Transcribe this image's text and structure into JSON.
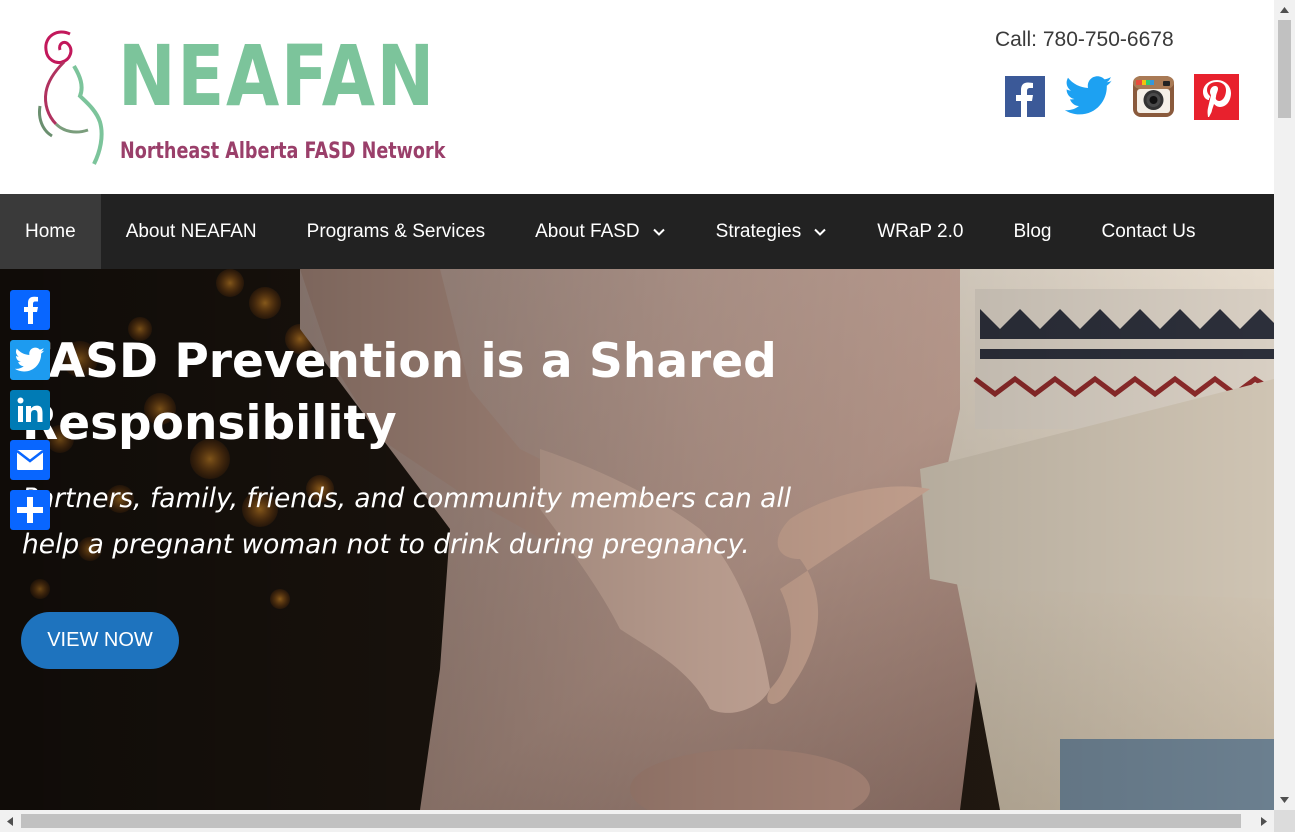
{
  "logo": {
    "title": "NEAFAN",
    "subtitle": "Northeast Alberta FASD Network"
  },
  "header": {
    "call": "Call: 780-750-6678",
    "social": [
      {
        "name": "facebook-icon",
        "color": "#3b5998"
      },
      {
        "name": "twitter-icon",
        "color": "#1da1f2"
      },
      {
        "name": "instagram-icon",
        "color": "#8a5a3c"
      },
      {
        "name": "pinterest-icon",
        "color": "#e8212d"
      }
    ]
  },
  "nav": {
    "items": [
      {
        "label": "Home",
        "active": true
      },
      {
        "label": "About NEAFAN"
      },
      {
        "label": "Programs & Services"
      },
      {
        "label": "About FASD",
        "dropdown": true
      },
      {
        "label": "Strategies",
        "dropdown": true
      },
      {
        "label": "WRaP 2.0"
      },
      {
        "label": "Blog"
      },
      {
        "label": "Contact Us"
      }
    ]
  },
  "hero": {
    "title": "FASD Prevention is a Shared Responsibility",
    "subtitle": "Partners, family, friends, and community members can all help a pregnant woman not to drink during pregnancy.",
    "button": "VIEW NOW"
  },
  "share_bar": [
    "facebook-share-icon",
    "twitter-share-icon",
    "linkedin-share-icon",
    "email-share-icon",
    "share-plus-icon"
  ],
  "colors": {
    "accent": "#1e73be",
    "nav_bg": "#222222",
    "logo_green": "#7cc49b",
    "logo_purple": "#9a3f6a"
  }
}
